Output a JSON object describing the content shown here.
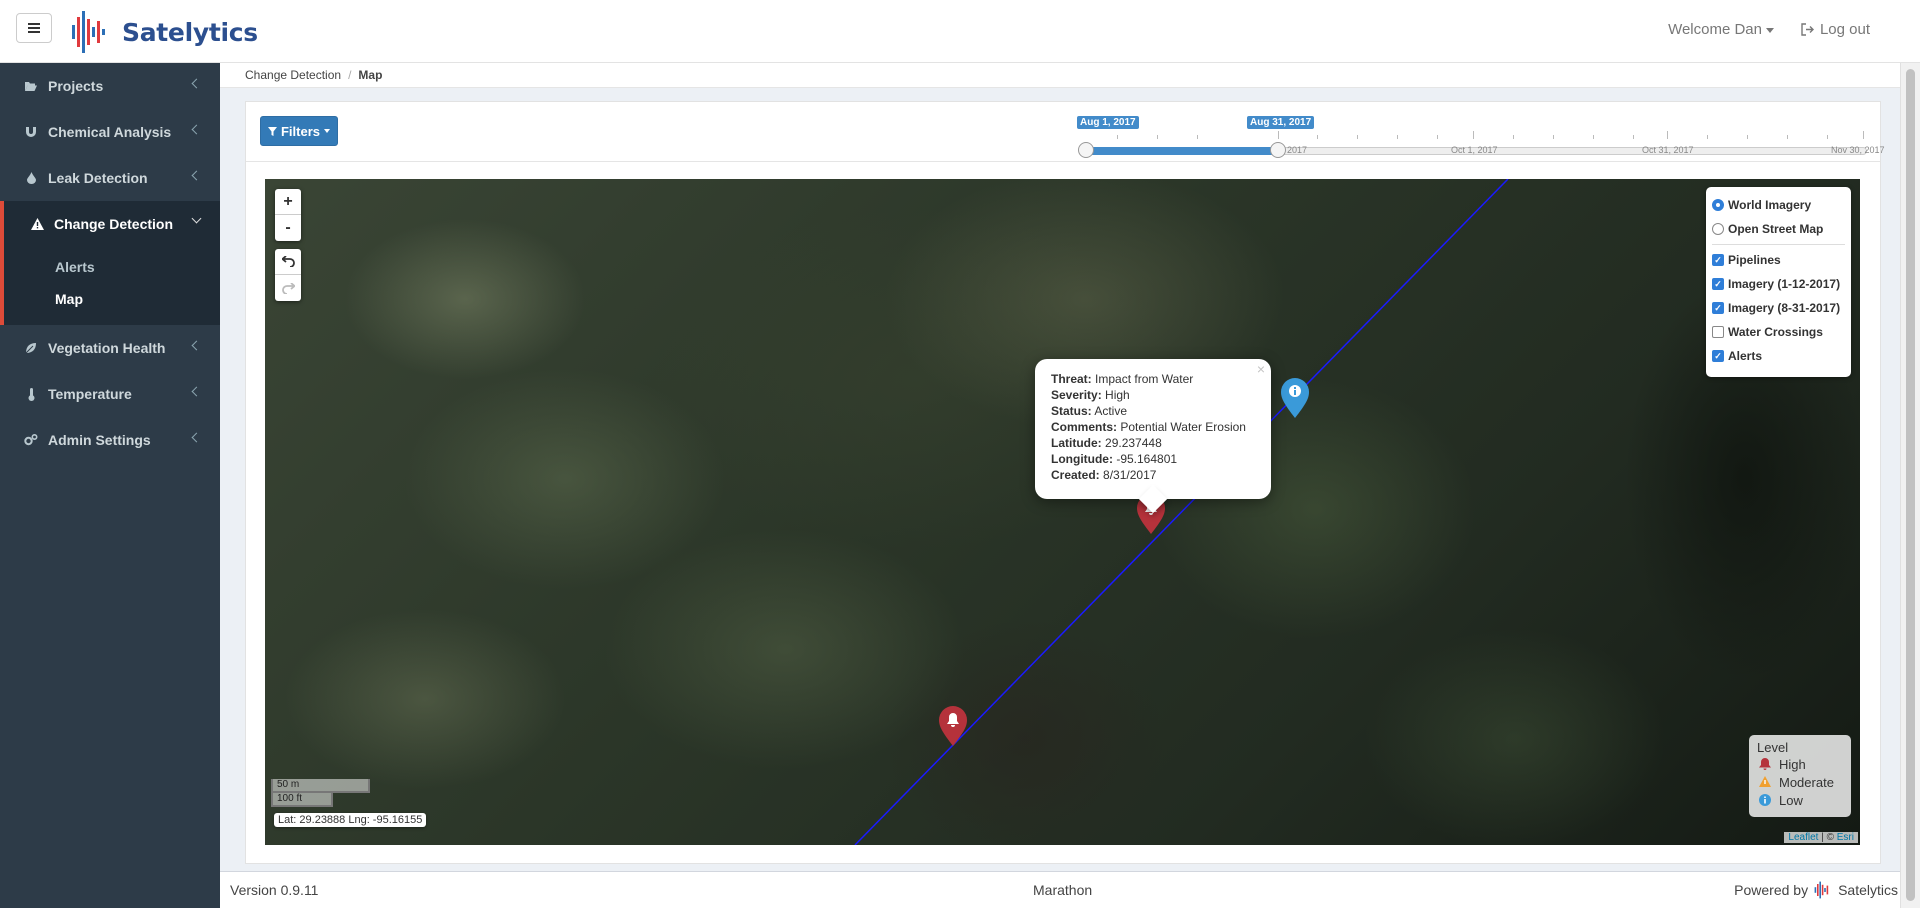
{
  "header": {
    "app_name": "Satelytics",
    "welcome": "Welcome Dan",
    "logout": "Log out"
  },
  "sidebar": {
    "items": [
      {
        "label": "Projects",
        "icon": "folder-open-icon"
      },
      {
        "label": "Chemical Analysis",
        "icon": "magnet-icon"
      },
      {
        "label": "Leak Detection",
        "icon": "droplet-icon"
      },
      {
        "label": "Change Detection",
        "icon": "warning-triangle-icon"
      },
      {
        "label": "Vegetation Health",
        "icon": "leaf-icon"
      },
      {
        "label": "Temperature",
        "icon": "thermometer-icon"
      },
      {
        "label": "Admin Settings",
        "icon": "gears-icon"
      }
    ],
    "submenu": [
      {
        "label": "Alerts"
      },
      {
        "label": "Map"
      }
    ]
  },
  "breadcrumb": {
    "parent": "Change Detection",
    "current": "Map"
  },
  "filters": {
    "label": "Filters"
  },
  "timeline": {
    "start_tag": "Aug 1, 2017",
    "end_tag": "Aug 31, 2017",
    "tick_labels": [
      "2017",
      "Oct 1, 2017",
      "Oct 31, 2017",
      "Nov 30, 2017"
    ]
  },
  "map": {
    "layers": {
      "base": [
        {
          "label": "World Imagery",
          "selected": true
        },
        {
          "label": "Open Street Map",
          "selected": false
        }
      ],
      "overlays": [
        {
          "label": "Pipelines",
          "checked": true
        },
        {
          "label": "Imagery (1-12-2017)",
          "checked": true
        },
        {
          "label": "Imagery (8-31-2017)",
          "checked": true
        },
        {
          "label": "Water Crossings",
          "checked": false
        },
        {
          "label": "Alerts",
          "checked": true
        }
      ]
    },
    "popup": {
      "threat_label": "Threat:",
      "threat": "Impact from Water",
      "severity_label": "Severity:",
      "severity": "High",
      "status_label": "Status:",
      "status": "Active",
      "comments_label": "Comments:",
      "comments": "Potential Water Erosion",
      "latitude_label": "Latitude:",
      "latitude": "29.237448",
      "longitude_label": "Longitude:",
      "longitude": "-95.164801",
      "created_label": "Created:",
      "created": "8/31/2017"
    },
    "legend": {
      "title": "Level",
      "items": [
        "High",
        "Moderate",
        "Low"
      ]
    },
    "scale": {
      "metric": "50 m",
      "imperial": "100 ft"
    },
    "coords": "Lat: 29.23888 Lng: -95.16155",
    "attribution": {
      "leaflet": "Leaflet",
      "sep": "| ©",
      "esri": "Esri"
    }
  },
  "footer": {
    "version": "Version 0.9.11",
    "center": "Marathon",
    "powered_by": "Powered by",
    "brand": "Satelytics"
  },
  "colors": {
    "sidebar_bg": "#2d3b48",
    "active_accent": "#dd4b39",
    "primary": "#337ab7",
    "alert_high": "#b5323b",
    "alert_moderate": "#f0a030",
    "alert_low": "#3a9ad9",
    "pipeline": "#1a1aff"
  }
}
